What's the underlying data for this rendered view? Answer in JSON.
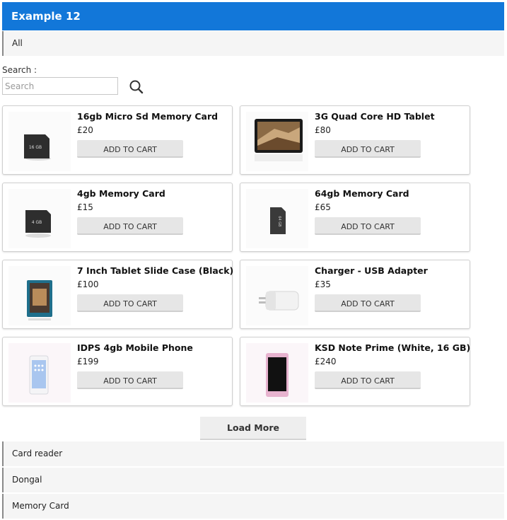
{
  "header": {
    "title": "Example 12"
  },
  "filter_top": {
    "label": "All"
  },
  "search": {
    "label": "Search :",
    "placeholder": "Search",
    "icon": "search-icon"
  },
  "products": [
    {
      "name": "16gb Micro Sd Memory Card",
      "price": "£20",
      "cart_label": "ADD TO CART"
    },
    {
      "name": "3G Quad Core HD Tablet",
      "price": "£80",
      "cart_label": "ADD TO CART"
    },
    {
      "name": "4gb Memory Card",
      "price": "£15",
      "cart_label": "ADD TO CART"
    },
    {
      "name": "64gb Memory Card",
      "price": "£65",
      "cart_label": "ADD TO CART"
    },
    {
      "name": "7 Inch Tablet Slide Case (Black)",
      "price": "£100",
      "cart_label": "ADD TO CART"
    },
    {
      "name": "Charger - USB Adapter",
      "price": "£35",
      "cart_label": "ADD TO CART"
    },
    {
      "name": "IDPS 4gb Mobile Phone",
      "price": "£199",
      "cart_label": "ADD TO CART"
    },
    {
      "name": "KSD Note Prime (White, 16 GB)",
      "price": "£240",
      "cart_label": "ADD TO CART"
    }
  ],
  "load_more": {
    "label": "Load More"
  },
  "categories": [
    {
      "label": "Card reader"
    },
    {
      "label": "Dongal"
    },
    {
      "label": "Memory Card"
    }
  ],
  "card_thumb_labels": {
    "sd16": "16 GB",
    "sd4": "4 GB",
    "sd64": "64 GB"
  },
  "colors": {
    "header_bg": "#1277d9",
    "header_text": "#ffffff"
  }
}
